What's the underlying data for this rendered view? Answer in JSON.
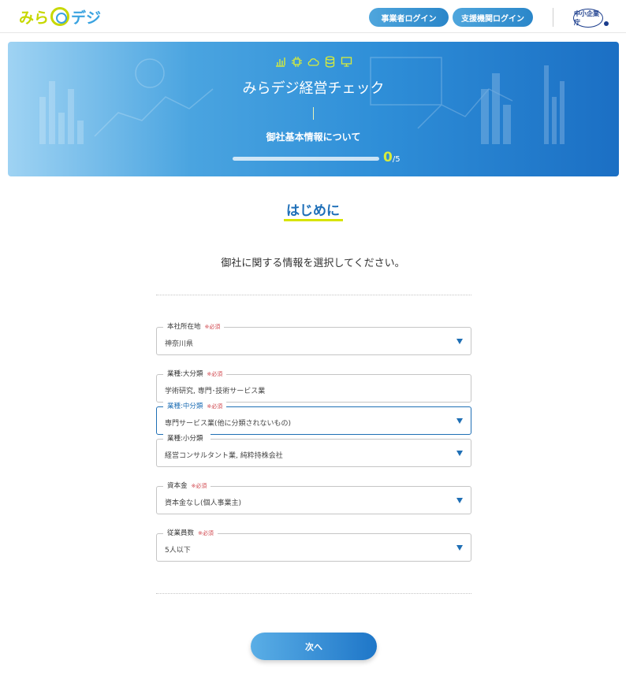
{
  "header": {
    "logo": {
      "part1": "みら",
      "part2": "デジ"
    },
    "login_business": "事業者ログイン",
    "login_support": "支援機関ログイン",
    "agency_logo": "中小企業庁"
  },
  "banner": {
    "icons": [
      "bar-chart-icon",
      "chip-icon",
      "cloud-icon",
      "database-icon",
      "monitor-icon"
    ],
    "title": "みらデジ経営チェック",
    "subtitle": "御社基本情報について",
    "progress": {
      "current": "0",
      "total": "/5",
      "fraction": 0
    }
  },
  "main": {
    "section_title": "はじめに",
    "instruction": "御社に関する情報を選択してください。",
    "fields": [
      {
        "label": "本社所在地",
        "required": "※必須",
        "value": "神奈川県",
        "dropdown": true
      },
      {
        "label": "業種:大分類",
        "required": "※必須",
        "value": "学術研究, 専門･技術サービス業",
        "dropdown": false
      },
      {
        "label": "業種:中分類",
        "required": "※必須",
        "value": "専門サービス業(他に分類されないもの)",
        "dropdown": true
      },
      {
        "label": "業種:小分類",
        "required": "",
        "value": "経営コンサルタント業, 純粋持株会社",
        "dropdown": true
      },
      {
        "label": "資本金",
        "required": "※必須",
        "value": "資本金なし(個人事業主)",
        "dropdown": true
      },
      {
        "label": "従業員数",
        "required": "※必須",
        "value": "5人以下",
        "dropdown": true
      }
    ],
    "next_button": "次へ"
  },
  "colors": {
    "accent_blue": "#1f6fb5",
    "accent_yellow": "#d8e400",
    "required_red": "#d0454c"
  }
}
